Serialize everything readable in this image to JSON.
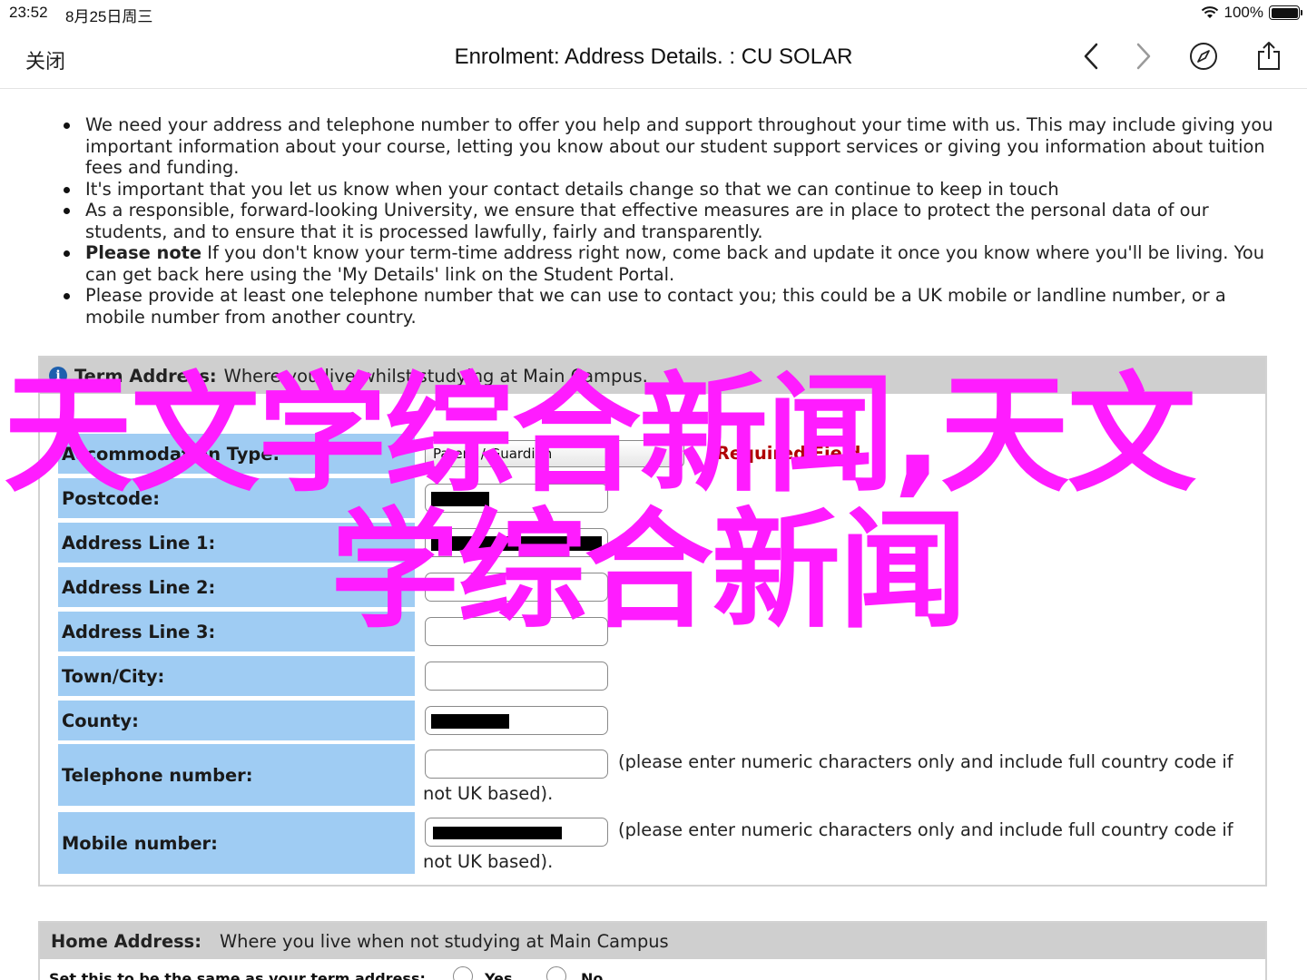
{
  "status_bar": {
    "time": "23:52",
    "date": "8月25日周三",
    "battery": "100%"
  },
  "nav": {
    "close_label": "关闭",
    "title": "Enrolment: Address Details. : CU SOLAR",
    "icons": [
      "back-icon",
      "forward-icon",
      "compass-icon",
      "share-icon"
    ]
  },
  "intro": {
    "b1": "We need your address and telephone number to offer you help and support throughout your time with us. This may include giving you important information about your course, letting you know about our student support services or giving you information about tuition fees and funding.",
    "b2": "It's important that you let us know when your contact details change so that we can continue to keep in touch",
    "b3": "As a responsible, forward-looking University, we ensure that effective measures are in place to protect the personal data of our students, and to ensure that it is processed lawfully, fairly and transparently.",
    "b4_bold": "Please note",
    "b4_rest": " If you don't know your term-time address right now, come back and update it once you know where you'll be living. You can get back here using the 'My Details' link on the Student Portal.",
    "b5": "Please provide at least one telephone number that we can use to contact you; this could be a UK mobile or landline number, or a mobile number from another country."
  },
  "term": {
    "heading": "Term Address:",
    "subheading": "Where you live whilst studying at Main Campus.",
    "accommodation_label": "Accommodation Type:",
    "accommodation_value": "Parent / Guardian",
    "required": "Required Field",
    "postcode_label": "Postcode:",
    "line1_label": "Address Line 1:",
    "line2_label": "Address Line 2:",
    "line3_label": "Address Line 3:",
    "town_label": "Town/City:",
    "county_label": "County:",
    "telephone_label": "Telephone number:",
    "mobile_label": "Mobile number:",
    "numeric_note": "(please enter numeric characters only and include full country code if",
    "numeric_note_cont": "not UK based)."
  },
  "home": {
    "heading": "Home Address:",
    "subheading": "Where you live when not studying at Main Campus",
    "same_question": "Set this to be the same as your term address:",
    "yes": "Yes",
    "no": "No"
  },
  "watermark": {
    "line1": "天文学综合新闻,天文",
    "line2": "学综合新闻",
    "color": "#ff1cff"
  }
}
